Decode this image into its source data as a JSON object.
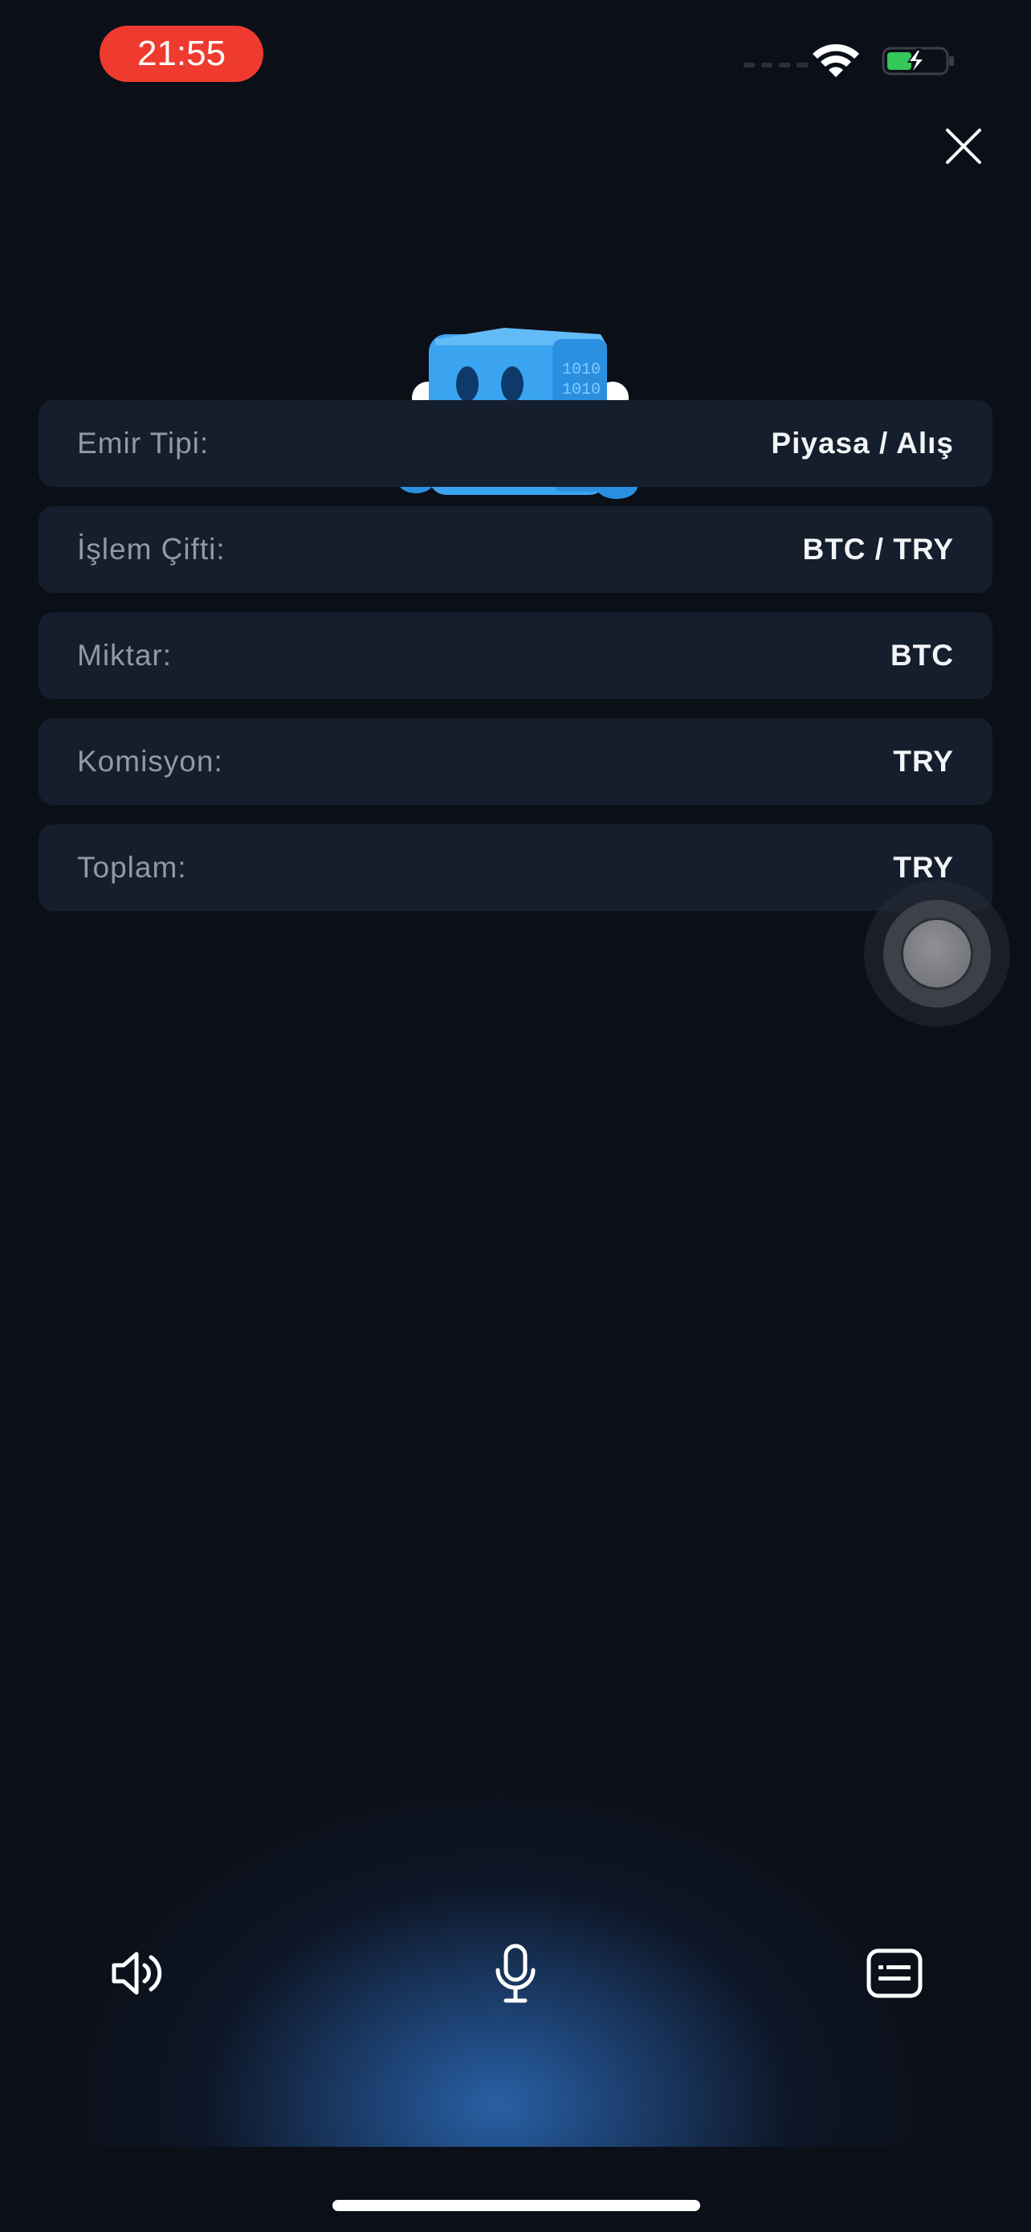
{
  "status_bar": {
    "time": "21:55"
  },
  "icons": {
    "close": "close-icon",
    "speaker": "speaker-icon",
    "microphone": "microphone-icon",
    "keyboard": "keyboard-icon",
    "wifi": "wifi-icon",
    "battery": "battery-charging-icon",
    "mascot": "robot-cube-mascot"
  },
  "order_summary": [
    {
      "label": "Emir Tipi:",
      "value": "Piyasa / Alış"
    },
    {
      "label": "İşlem Çifti:",
      "value": "BTC / TRY"
    },
    {
      "label": "Miktar:",
      "value": "BTC"
    },
    {
      "label": "Komisyon:",
      "value": "TRY"
    },
    {
      "label": "Toplam:",
      "value": "TRY"
    }
  ],
  "colors": {
    "background": "#0b0f18",
    "row_background": "#151e2c",
    "time_pill": "#ef3b2f",
    "accent_glow": "#2d6ebe",
    "mascot_blue": "#3ba4f0"
  }
}
